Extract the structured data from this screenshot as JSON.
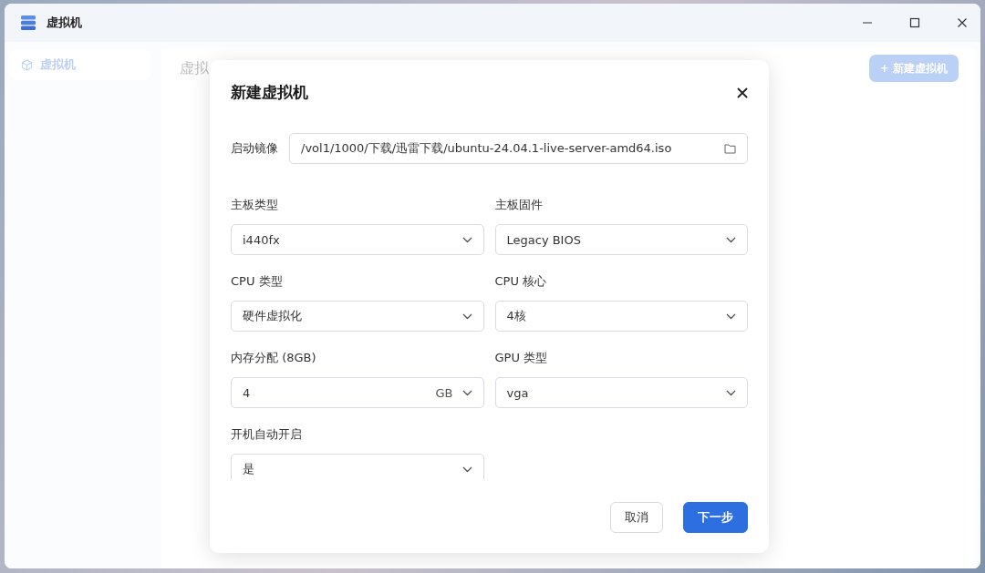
{
  "window": {
    "title": "虚拟机"
  },
  "sidebar": {
    "items": [
      {
        "label": "虚拟机",
        "selected": true
      }
    ]
  },
  "page": {
    "heading": "虚拟",
    "add_button": "+ 新建虚拟机"
  },
  "dialog": {
    "title": "新建虚拟机",
    "image_field": {
      "label": "启动镜像",
      "value": "/vol1/1000/下载/迅雷下载/ubuntu-24.04.1-live-server-amd64.iso"
    },
    "fields": [
      {
        "label": "主板类型",
        "kind": "select",
        "value": "i440fx"
      },
      {
        "label": "主板固件",
        "kind": "select",
        "value": "Legacy BIOS"
      },
      {
        "label": "CPU 类型",
        "kind": "select",
        "value": "硬件虚拟化"
      },
      {
        "label": "CPU 核心",
        "kind": "select",
        "value": "4核"
      },
      {
        "label": "内存分配 (8GB)",
        "kind": "unit",
        "value": "4",
        "unit": "GB"
      },
      {
        "label": "GPU 类型",
        "kind": "select",
        "value": "vga"
      },
      {
        "label": "开机自动开启",
        "kind": "select",
        "value": "是"
      }
    ],
    "buttons": [
      {
        "label": "取消",
        "kind": "secondary"
      },
      {
        "label": "下一步",
        "kind": "primary"
      }
    ]
  }
}
